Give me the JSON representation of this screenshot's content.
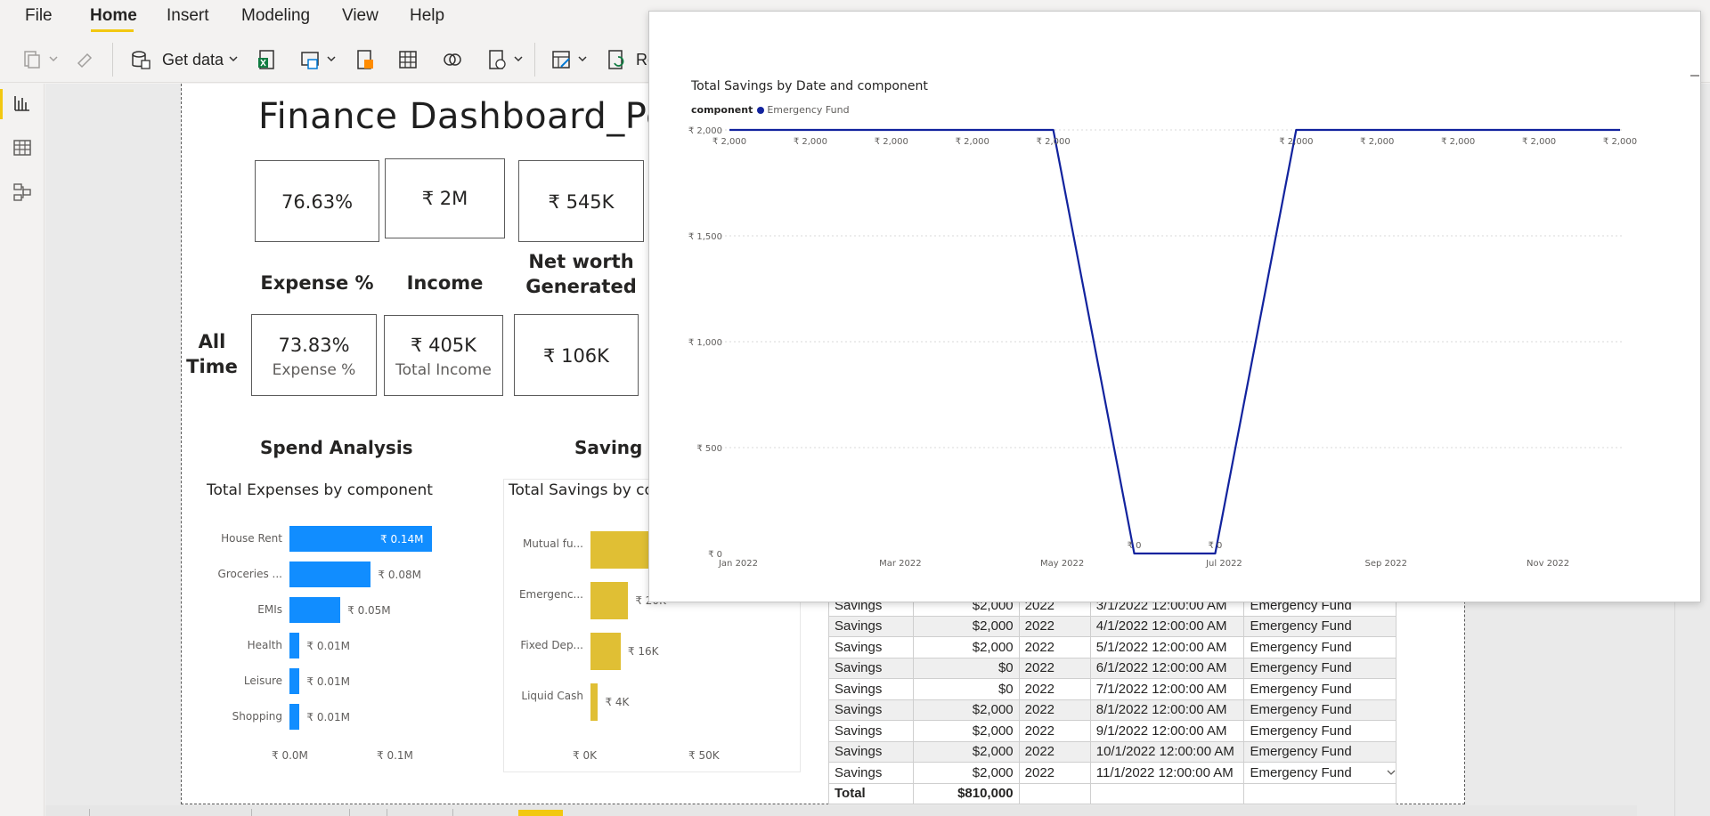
{
  "ribbon": {
    "menu": [
      {
        "id": "file",
        "label": "File"
      },
      {
        "id": "home",
        "label": "Home"
      },
      {
        "id": "insert",
        "label": "Insert"
      },
      {
        "id": "modeling",
        "label": "Modeling"
      },
      {
        "id": "view",
        "label": "View"
      },
      {
        "id": "help",
        "label": "Help"
      }
    ],
    "active_tab": "Home",
    "get_data_label": "Get data",
    "refresh_label_partial": "Re"
  },
  "dashboard": {
    "title": "Finance Dashboard_Pers",
    "cards_top": [
      {
        "id": "expense-pct",
        "value": "76.63%"
      },
      {
        "id": "income",
        "value": "₹ 2M"
      },
      {
        "id": "net-worth",
        "value": "₹ 545K"
      }
    ],
    "labels": {
      "expense": "Expense %",
      "income": "Income",
      "net_worth": "Net worth Generated",
      "all_time": "All Time"
    },
    "cards_all_time": [
      {
        "id": "expense-pct-all",
        "value": "73.83%",
        "sub": "Expense %"
      },
      {
        "id": "income-all",
        "value": "₹ 405K",
        "sub": "Total Income"
      },
      {
        "id": "net-worth-all",
        "value": "₹ 106K"
      }
    ],
    "sections": {
      "spend": "Spend Analysis",
      "saving": "Saving A"
    }
  },
  "charts": {
    "expenses_by_component": {
      "title": "Total Expenses by component",
      "type": "bar",
      "orientation": "horizontal",
      "color": "#118dff",
      "categories": [
        "House Rent",
        "Groceries ...",
        "EMIs",
        "Health",
        "Leisure",
        "Shopping"
      ],
      "values": [
        0.14,
        0.08,
        0.05,
        0.01,
        0.01,
        0.01
      ],
      "value_labels": [
        "₹ 0.14M",
        "₹ 0.08M",
        "₹ 0.05M",
        "₹ 0.01M",
        "₹ 0.01M",
        "₹ 0.01M"
      ],
      "ticks": [
        "₹ 0.0M",
        "₹ 0.1M"
      ]
    },
    "savings_by_component": {
      "title": "Total Savings by co",
      "type": "bar",
      "orientation": "horizontal",
      "color": "#e0bf34",
      "categories": [
        "Mutual fu...",
        "Emergenc...",
        "Fixed Dep...",
        "Liquid Cash"
      ],
      "values": [
        34,
        20,
        16,
        4
      ],
      "value_labels": [
        "",
        "₹ 20K",
        "₹ 16K",
        "₹ 4K"
      ],
      "ticks": [
        "₹ 0K",
        "₹ 50K"
      ]
    }
  },
  "table": {
    "rows": [
      [
        "Savings",
        "$2,000",
        "2022",
        "3/1/2022 12:00:00 AM",
        "Emergency Fund"
      ],
      [
        "Savings",
        "$2,000",
        "2022",
        "4/1/2022 12:00:00 AM",
        "Emergency Fund"
      ],
      [
        "Savings",
        "$2,000",
        "2022",
        "5/1/2022 12:00:00 AM",
        "Emergency Fund"
      ],
      [
        "Savings",
        "$0",
        "2022",
        "6/1/2022 12:00:00 AM",
        "Emergency Fund"
      ],
      [
        "Savings",
        "$0",
        "2022",
        "7/1/2022 12:00:00 AM",
        "Emergency Fund"
      ],
      [
        "Savings",
        "$2,000",
        "2022",
        "8/1/2022 12:00:00 AM",
        "Emergency Fund"
      ],
      [
        "Savings",
        "$2,000",
        "2022",
        "9/1/2022 12:00:00 AM",
        "Emergency Fund"
      ],
      [
        "Savings",
        "$2,000",
        "2022",
        "10/1/2022 12:00:00 AM",
        "Emergency Fund"
      ],
      [
        "Savings",
        "$2,000",
        "2022",
        "11/1/2022 12:00:00 AM",
        "Emergency Fund"
      ]
    ],
    "total_label": "Total",
    "total_value": "$810,000"
  },
  "chart_data": {
    "type": "line",
    "title": "Total Savings by Date and component",
    "legend_title": "component",
    "legend_position": "top-left",
    "series": [
      {
        "name": "Emergency Fund",
        "color": "#12239e",
        "values": [
          2000,
          2000,
          2000,
          2000,
          2000,
          0,
          0,
          2000,
          2000,
          2000,
          2000,
          2000
        ]
      }
    ],
    "x": [
      "2022-01-01",
      "2022-02-01",
      "2022-03-01",
      "2022-04-01",
      "2022-05-01",
      "2022-06-01",
      "2022-07-01",
      "2022-08-01",
      "2022-09-01",
      "2022-10-01",
      "2022-11-01",
      "2022-12-01"
    ],
    "data_labels": [
      "₹ 2,000",
      "₹ 2,000",
      "₹ 2,000",
      "₹ 2,000",
      "₹ 2,000",
      "₹ 0",
      "₹ 0",
      "₹ 2,000",
      "₹ 2,000",
      "₹ 2,000",
      "₹ 2,000",
      "₹ 2,000"
    ],
    "x_ticks": [
      "Jan 2022",
      "Mar 2022",
      "May 2022",
      "Jul 2022",
      "Sep 2022",
      "Nov 2022"
    ],
    "x_tick_index": [
      0,
      2,
      4,
      6,
      8,
      10
    ],
    "y_ticks": [
      "₹ 0",
      "₹ 500",
      "₹ 1,000",
      "₹ 1,500",
      "₹ 2,000"
    ],
    "y_tick_values": [
      0,
      500,
      1000,
      1500,
      2000
    ],
    "ylim": [
      0,
      2000
    ],
    "grid": true
  }
}
